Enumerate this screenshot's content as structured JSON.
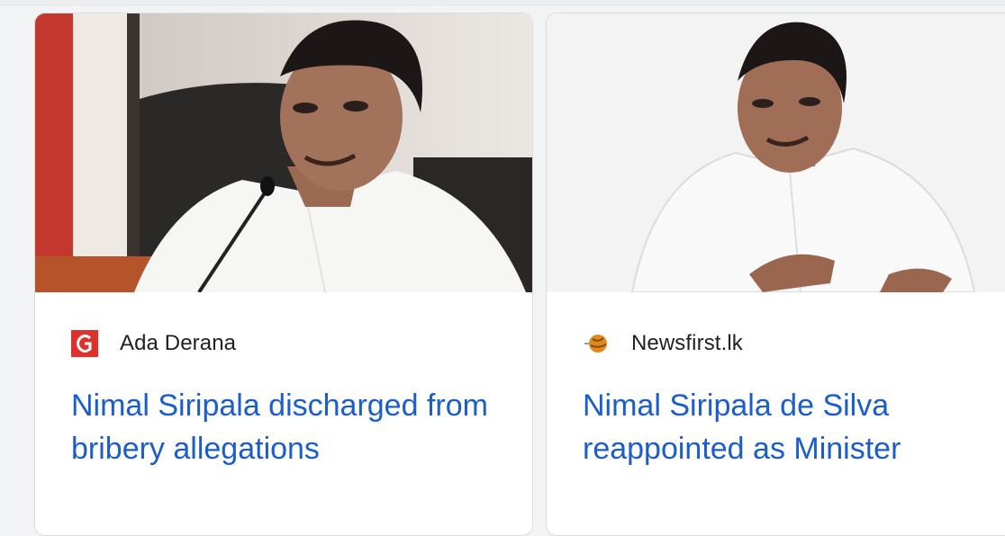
{
  "cards": [
    {
      "source": "Ada Derana",
      "favicon": "ada-derana-logo-icon",
      "headline": "Nimal Siripala discharged from bribery allegations"
    },
    {
      "source": "Newsfirst.lk",
      "favicon": "newsfirst-globe-icon",
      "headline": "Nimal Siripala de Silva reappointed as Minister"
    }
  ],
  "colors": {
    "headline": "#1a5dcc",
    "source": "#202124",
    "card_border": "#dadce0"
  }
}
